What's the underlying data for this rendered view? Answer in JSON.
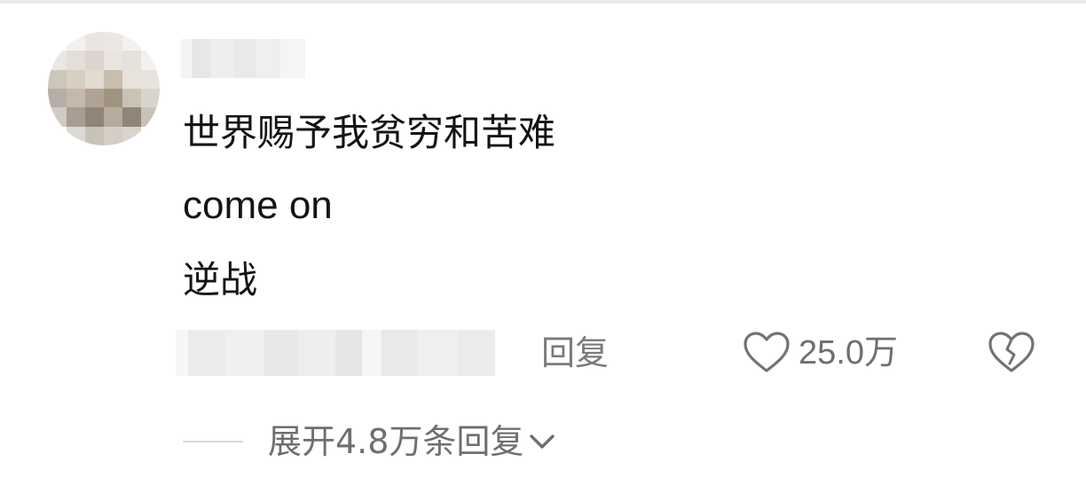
{
  "comment": {
    "lines": [
      "世界赐予我贫穷和苦难",
      "come on",
      "逆战"
    ]
  },
  "actions": {
    "reply_label": "回复",
    "like_count": "25.0万",
    "like_icon": "heart-outline-icon",
    "dislike_icon": "broken-heart-icon"
  },
  "replies": {
    "expand_label": "展开4.8万条回复",
    "expand_icon": "chevron-down-icon"
  },
  "colors": {
    "text_primary": "#141414",
    "text_secondary": "#6f6f6f",
    "background": "#ffffff"
  }
}
